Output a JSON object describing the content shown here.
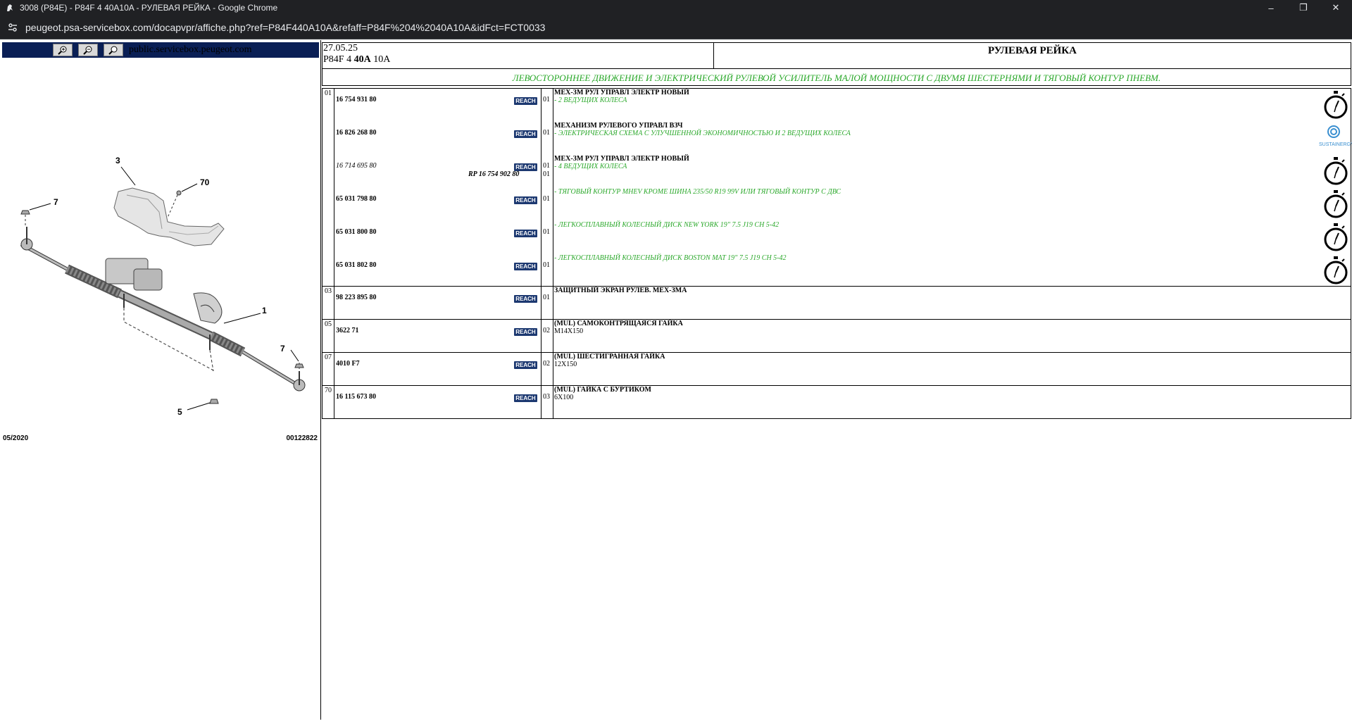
{
  "window": {
    "title": "3008 (P84E) - P84F 4 40A10A - РУЛЕВАЯ РЕЙКА - Google Chrome",
    "url": "peugeot.psa-servicebox.com/docapvpr/affiche.php?ref=P84F440A10A&refaff=P84F%204%2040A10A&idFct=FCT0033",
    "minimize": "–",
    "restore": "❐",
    "close": "✕"
  },
  "left": {
    "domain_text": "public.servicebox.peugeot.com",
    "callouts": [
      "3",
      "70",
      "7",
      "1",
      "7",
      "5"
    ],
    "footer_left": "05/2020",
    "footer_right": "00122822"
  },
  "header": {
    "date": "27.05.25",
    "ref_prefix": "P84F 4 ",
    "ref_bold": "40A",
    "ref_suffix": " 10A",
    "title": "РУЛЕВАЯ РЕЙКА"
  },
  "subtitle": "ЛЕВОСТОРОННЕЕ ДВИЖЕНИЕ И ЭЛЕКТРИЧЕСКИЙ РУЛЕВОЙ УСИЛИТЕЛЬ МАЛОЙ МОЩНОСТИ С ДВУМЯ ШЕСТЕРНЯМИ И ТЯГОВЫЙ КОНТУР ПНЕВМ.",
  "reach_label": "REACH",
  "groups": [
    {
      "index": "01",
      "rows": [
        {
          "ref": "16 754 931 80",
          "qty": "01",
          "name": "МЕХ-ЗМ РУЛ УПРАВЛ ЭЛЕКТР НОВЫЙ",
          "note": "- 2 ВЕДУЩИХ КОЛЕСА"
        },
        {
          "ref": "16 826 268 80",
          "qty": "01",
          "name": "МЕХАНИЗМ РУЛЕВОГО УПРАВЛ ВЗЧ",
          "note": "- ЭЛЕКТРИЧЕСКАЯ СХЕМА С УЛУЧШЕННОЙ ЭКОНОМИЧНОСТЬЮ И 2 ВЕДУЩИХ КОЛЕСА"
        },
        {
          "ref": "16 714 695 80",
          "qty": "01",
          "name": "МЕХ-ЗМ РУЛ УПРАВЛ ЭЛЕКТР НОВЫЙ",
          "note": "- 4 ВЕДУЩИХ КОЛЕСА",
          "rp": "RP 16 754 902 80",
          "rp_qty": "01"
        },
        {
          "ref": "65 031 798 80",
          "qty": "01",
          "name": "",
          "note": "- ТЯГОВЫЙ КОНТУР MHEV КРОМЕ ШИНА 235/50 R19 99V ИЛИ ТЯГОВЫЙ КОНТУР С ДВС"
        },
        {
          "ref": "65 031 800 80",
          "qty": "01",
          "name": "",
          "note": "- ЛЕГКОСПЛАВНЫЙ КОЛЕСНЫЙ ДИСК NEW YORK 19\" 7.5 J19 CH 5-42"
        },
        {
          "ref": "65 031 802 80",
          "qty": "01",
          "name": "",
          "note": "- ЛЕГКОСПЛАВНЫЙ КОЛЕСНЫЙ ДИСК BOSTON MAT 19\" 7.5 J19 CH 5-42"
        }
      ],
      "sustain_label": "SUSTAINERGY"
    },
    {
      "index": "03",
      "rows": [
        {
          "ref": "98 223 895 80",
          "qty": "01",
          "name": "ЗАЩИТНЫЙ ЭКРАН РУЛЕВ. МЕХ-ЗМА",
          "note": ""
        }
      ]
    },
    {
      "index": "05",
      "rows": [
        {
          "ref": "3622 71",
          "qty": "02",
          "name": "(MUL) САМОКОНТРЯЩАЯСЯ ГАЙКА",
          "note": "M14X150"
        }
      ]
    },
    {
      "index": "07",
      "rows": [
        {
          "ref": "4010 F7",
          "qty": "02",
          "name": "(MUL) ШЕСТИГРАННАЯ ГАЙКА",
          "note": "12X150"
        }
      ]
    },
    {
      "index": "70",
      "rows": [
        {
          "ref": "16 115 673 80",
          "qty": "03",
          "name": "(MUL) ГАЙКА С БУРТИКОМ",
          "note": "6X100"
        }
      ]
    }
  ]
}
